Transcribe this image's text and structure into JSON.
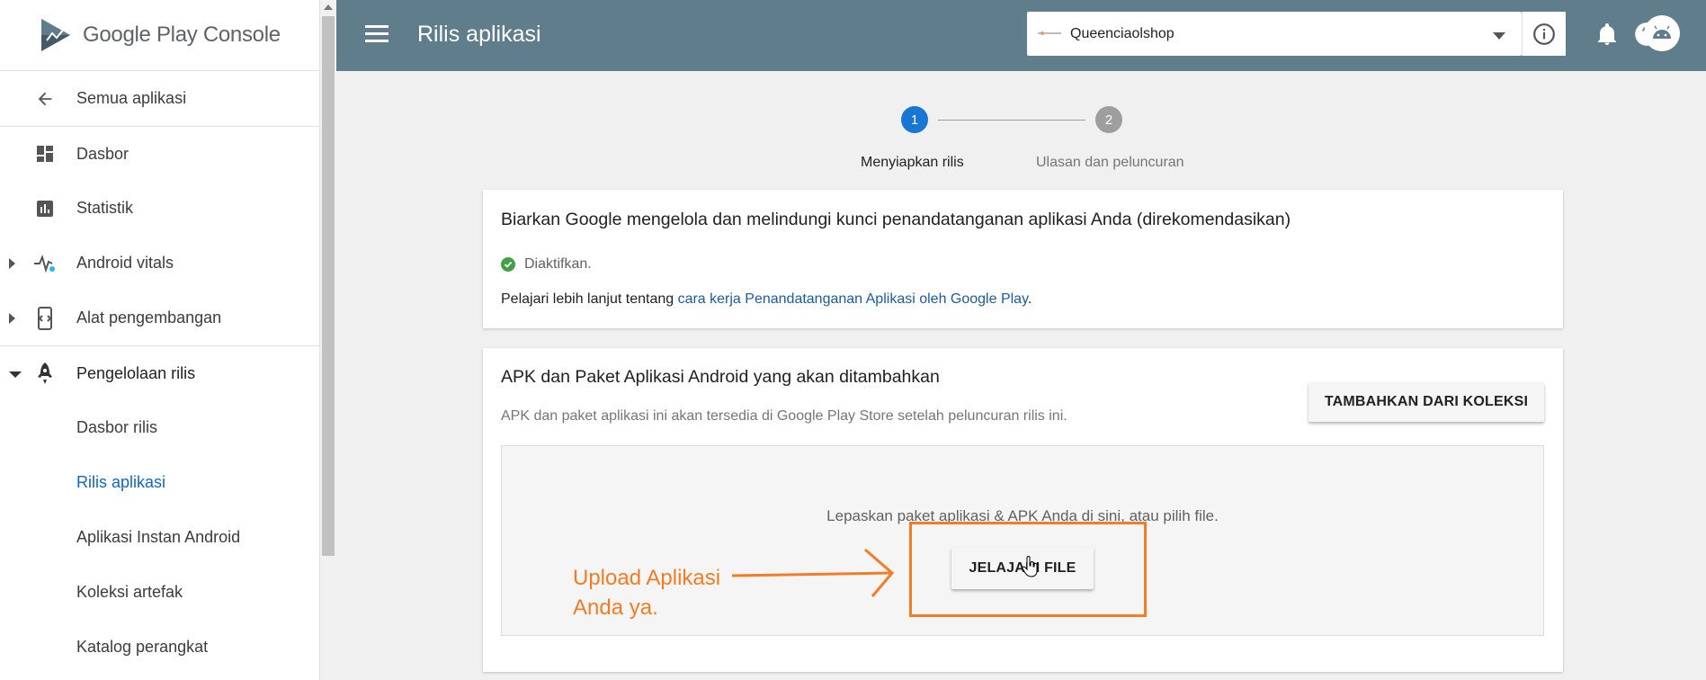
{
  "brand": {
    "name_google": "Google Play",
    "name_console": "Console"
  },
  "sidebar": {
    "back": "Semua aplikasi",
    "items": [
      {
        "label": "Dasbor"
      },
      {
        "label": "Statistik"
      },
      {
        "label": "Android vitals"
      },
      {
        "label": "Alat pengembangan"
      },
      {
        "label": "Pengelolaan rilis"
      },
      {
        "label": "Dasbor rilis"
      },
      {
        "label": "Rilis aplikasi"
      },
      {
        "label": "Aplikasi Instan Android"
      },
      {
        "label": "Koleksi artefak"
      },
      {
        "label": "Katalog perangkat"
      }
    ]
  },
  "header": {
    "title": "Rilis aplikasi",
    "app_name": "Queenciaolshop"
  },
  "stepper": {
    "steps": [
      {
        "number": "1",
        "label": "Menyiapkan rilis",
        "active": true
      },
      {
        "number": "2",
        "label": "Ulasan dan peluncuran",
        "active": false
      }
    ]
  },
  "signing_card": {
    "title": "Biarkan Google mengelola dan melindungi kunci penandatanganan aplikasi Anda (direkomendasikan)",
    "status": "Diaktifkan.",
    "learn_prefix": "Pelajari lebih lanjut tentang ",
    "learn_link": "cara kerja Penandatanganan Aplikasi oleh Google Play",
    "learn_suffix": "."
  },
  "apk_card": {
    "title": "APK dan Paket Aplikasi Android yang akan ditambahkan",
    "subtitle": "APK dan paket aplikasi ini akan tersedia di Google Play Store setelah peluncuran rilis ini.",
    "add_button": "TAMBAHKAN DARI KOLEKSI",
    "drop_text": "Lepaskan paket aplikasi & APK Anda di sini, atau pilih file.",
    "browse_button": "JELAJAHI FILE"
  },
  "annotation": {
    "line1": "Upload Aplikasi",
    "line2": "Anda ya."
  },
  "colors": {
    "topbar": "#607d8b",
    "accent": "#1976d2",
    "annotation": "#f47c25"
  }
}
